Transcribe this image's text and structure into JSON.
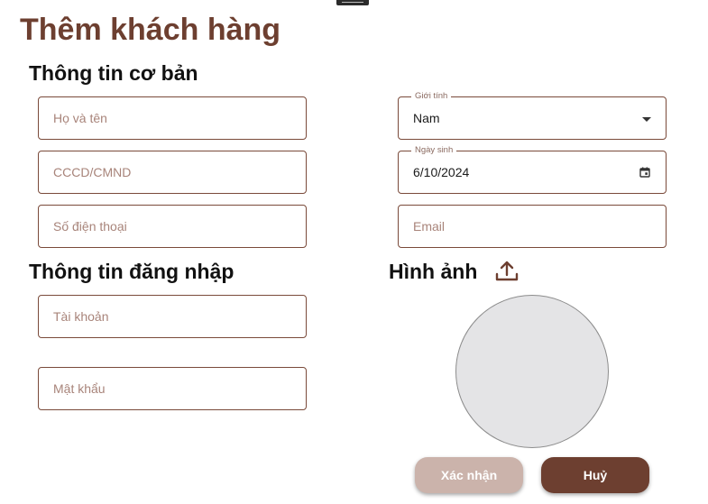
{
  "page": {
    "title": "Thêm khách hàng"
  },
  "sections": {
    "basic_info": "Thông tin cơ bản",
    "login_info": "Thông tin đăng nhập",
    "image": "Hình ảnh"
  },
  "basic": {
    "fullname": {
      "placeholder": "Họ và tên"
    },
    "id_card": {
      "placeholder": "CCCD/CMND"
    },
    "phone": {
      "placeholder": "Số điện thoại"
    },
    "gender": {
      "label": "Giới tính",
      "value": "Nam"
    },
    "birthdate": {
      "label": "Ngày sinh",
      "value": "6/10/2024"
    },
    "email": {
      "placeholder": "Email"
    }
  },
  "login": {
    "account": {
      "placeholder": "Tài khoản"
    },
    "password": {
      "placeholder": "Mật khẩu"
    }
  },
  "icons": {
    "upload": "upload-icon",
    "dropdown": "chevron-down-icon",
    "calendar": "calendar-icon"
  },
  "buttons": {
    "confirm": "Xác nhận",
    "cancel": "Huỷ"
  },
  "colors": {
    "brand": "#6d3f30",
    "confirm_bg": "#cbb3ab",
    "field_border": "#7a4a3a",
    "avatar_bg": "#e4e4e6"
  }
}
